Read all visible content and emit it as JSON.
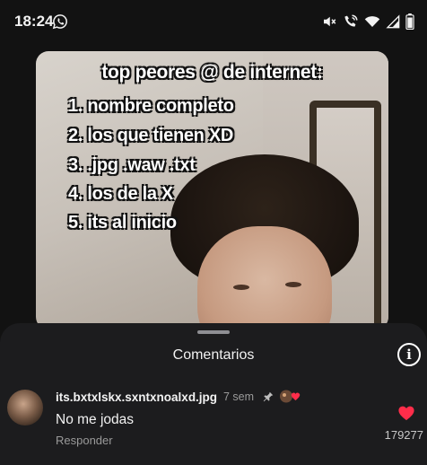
{
  "status_bar": {
    "time": "18:24",
    "icons": [
      "whatsapp-icon",
      "mute-icon",
      "wifi-calling-icon",
      "wifi-icon",
      "signal-icon",
      "battery-icon"
    ]
  },
  "video": {
    "overlay_title": "top peores @ de internet:",
    "overlay_items": [
      "1. nombre completo",
      "2. los que tienen XD",
      "3. .jpg .waw .txt",
      "4. los de la X",
      "5. its al inicio"
    ]
  },
  "comments_sheet": {
    "title": "Comentarios",
    "info_icon": "info-icon",
    "comment": {
      "username": "its.bxtxlskx.sxntxnoalxd.jpg",
      "time": "7 sem",
      "pinned_icon": "pin-icon",
      "creator_badge_icon": "creator-liked-icon",
      "text": "No me jodas",
      "reply_label": "Responder",
      "like_icon": "heart-icon",
      "like_count": "179277"
    }
  },
  "colors": {
    "sheet_background": "#1c1c1e",
    "like_heart": "#ff2d4a",
    "secondary_text": "#9a9a9a"
  }
}
